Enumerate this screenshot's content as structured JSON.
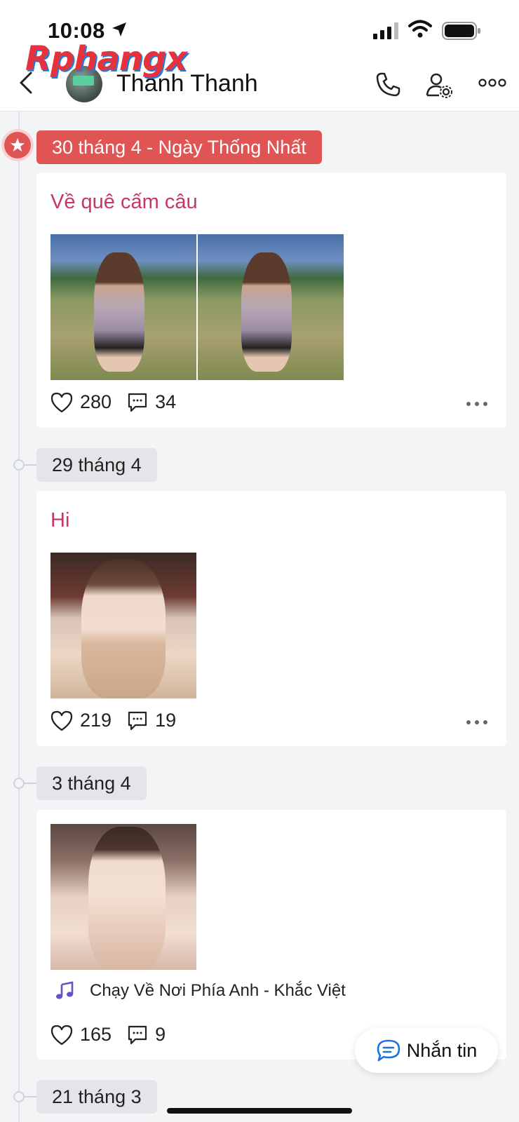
{
  "status_bar": {
    "time": "10:08"
  },
  "watermark": {
    "text": "Rphangx"
  },
  "header": {
    "name": "Thanh Thanh",
    "icons": [
      "back-chevron-icon",
      "phone-icon",
      "user-settings-icon",
      "more-icon"
    ]
  },
  "timeline": [
    {
      "date": "30 tháng 4 - Ngày Thống Nhất",
      "highlight": true,
      "caption": "Về quê cấm câu",
      "likes": "280",
      "comments": "34"
    },
    {
      "date": "29 tháng 4",
      "caption": "Hi",
      "likes": "219",
      "comments": "19"
    },
    {
      "date": "3 tháng 4",
      "music": "Chạy Về Nơi Phía Anh - Khắc Việt",
      "likes": "165",
      "comments": "9"
    },
    {
      "date": "21 tháng 3"
    }
  ],
  "chat_button": {
    "label": "Nhắn tin"
  },
  "colors": {
    "accent_red": "#e05453",
    "caption_pink": "#c8356a"
  }
}
